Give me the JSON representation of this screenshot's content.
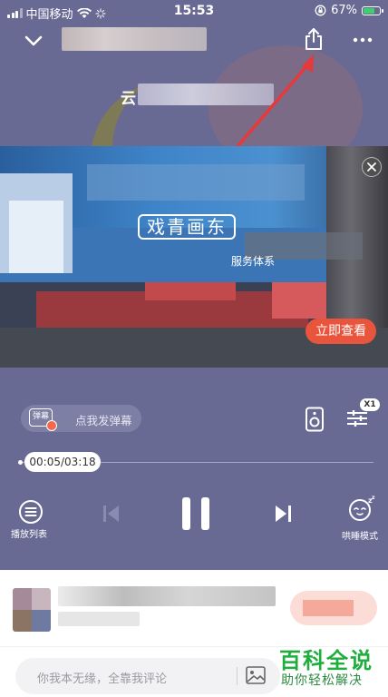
{
  "status_bar": {
    "carrier": "中国移动",
    "time": "15:53",
    "battery": "67%"
  },
  "header": {
    "lyric_fragment": "云"
  },
  "ad": {
    "title": "戏青画东",
    "subtitle": "服务体系",
    "cta": "立即查看"
  },
  "controls": {
    "danmu_badge": "弹幕",
    "danmu_label": "点我发弹幕",
    "speed": "X1",
    "progress_text": "00:05/03:18",
    "playlist_label": "播放列表",
    "sleep_label": "哄睡模式"
  },
  "comment": {
    "placeholder": "你我本无缘，全靠我评论"
  },
  "watermark": {
    "title": "百科全说",
    "subtitle": "助你轻松解决"
  },
  "colors": {
    "player_bg": "#696a94",
    "ad_button": "#e8553c",
    "watermark": "#1fae3e"
  }
}
